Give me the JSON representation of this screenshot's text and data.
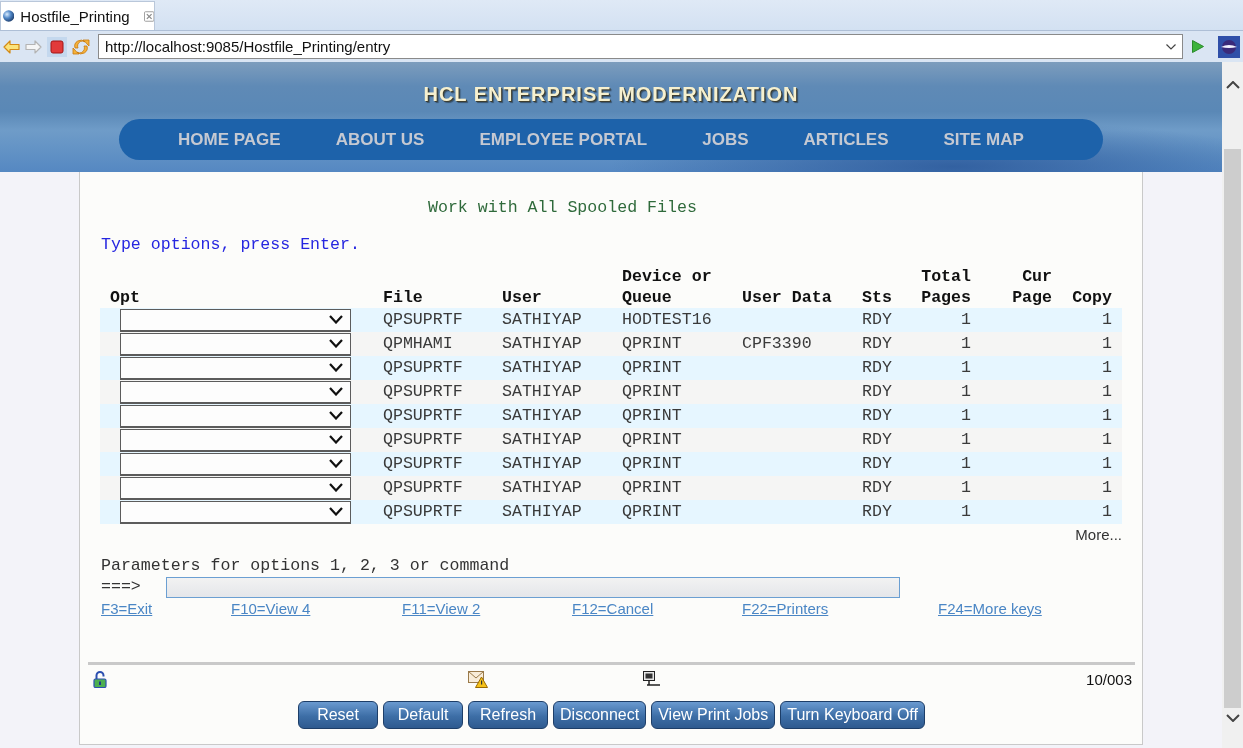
{
  "browser": {
    "tab": {
      "title": "Hostfile_Printing"
    },
    "url": "http://localhost:9085/Hostfile_Printing/entry"
  },
  "banner": {
    "title": "HCL ENTERPRISE MODERNIZATION",
    "nav": [
      "HOME PAGE",
      "ABOUT US",
      "EMPLOYEE PORTAL",
      "JOBS",
      "ARTICLES",
      "SITE MAP"
    ]
  },
  "screen": {
    "title": "Work with All Spooled Files",
    "instruction": "Type options, press Enter.",
    "columns": [
      {
        "kind": "select",
        "lines": [
          "Opt"
        ]
      },
      {
        "kind": "text",
        "lines": [
          "File"
        ]
      },
      {
        "kind": "text",
        "lines": [
          "User"
        ]
      },
      {
        "kind": "text",
        "lines": [
          "Device or",
          "Queue"
        ]
      },
      {
        "kind": "text",
        "lines": [
          "User Data"
        ]
      },
      {
        "kind": "text",
        "lines": [
          "Sts"
        ]
      },
      {
        "kind": "number",
        "lines": [
          "Total",
          "Pages"
        ]
      },
      {
        "kind": "number",
        "lines": [
          "Cur",
          "Page"
        ]
      },
      {
        "kind": "number",
        "lines": [
          "Copy"
        ]
      }
    ],
    "rows": [
      {
        "file": "QPSUPRTF",
        "user": "SATHIYAP",
        "device": "HODTEST16",
        "sts": "RDY",
        "total_pages": "1",
        "copy": "1"
      },
      {
        "file": "QPMHAMI",
        "user": "SATHIYAP",
        "device": "QPRINT",
        "user_data": "CPF3390",
        "sts": "RDY",
        "total_pages": "1",
        "copy": "1"
      },
      {
        "file": "QPSUPRTF",
        "user": "SATHIYAP",
        "device": "QPRINT",
        "sts": "RDY",
        "total_pages": "1",
        "copy": "1"
      },
      {
        "file": "QPSUPRTF",
        "user": "SATHIYAP",
        "device": "QPRINT",
        "sts": "RDY",
        "total_pages": "1",
        "copy": "1"
      },
      {
        "file": "QPSUPRTF",
        "user": "SATHIYAP",
        "device": "QPRINT",
        "sts": "RDY",
        "total_pages": "1",
        "copy": "1"
      },
      {
        "file": "QPSUPRTF",
        "user": "SATHIYAP",
        "device": "QPRINT",
        "sts": "RDY",
        "total_pages": "1",
        "copy": "1"
      },
      {
        "file": "QPSUPRTF",
        "user": "SATHIYAP",
        "device": "QPRINT",
        "sts": "RDY",
        "total_pages": "1",
        "copy": "1"
      },
      {
        "file": "QPSUPRTF",
        "user": "SATHIYAP",
        "device": "QPRINT",
        "sts": "RDY",
        "total_pages": "1",
        "copy": "1"
      },
      {
        "file": "QPSUPRTF",
        "user": "SATHIYAP",
        "device": "QPRINT",
        "sts": "RDY",
        "total_pages": "1",
        "copy": "1"
      }
    ],
    "more": "More...",
    "parameters": {
      "label": "Parameters for options 1, 2, 3 or command",
      "prompt": "===>"
    },
    "function_keys": [
      "F3=Exit",
      "F10=View 4",
      "F11=View 2",
      "F12=Cancel",
      "F22=Printers",
      "F24=More keys"
    ]
  },
  "status": {
    "cursor": "10/003"
  },
  "buttons": [
    "Reset",
    "Default",
    "Refresh",
    "Disconnect",
    "View Print Jobs",
    "Turn Keyboard Off"
  ]
}
